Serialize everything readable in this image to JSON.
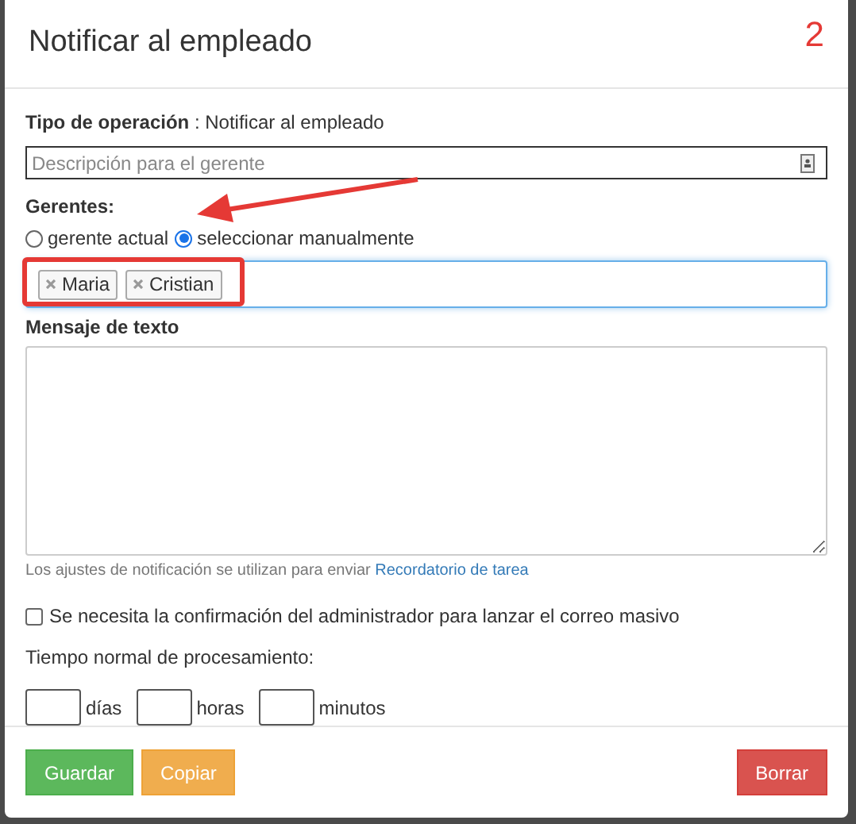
{
  "dialog": {
    "title": "Notificar al empleado",
    "annotation_number": "2"
  },
  "operation": {
    "label": "Tipo de operación",
    "value": " : Notificar al empleado"
  },
  "description_field": {
    "placeholder": "Descripción para el gerente"
  },
  "managers": {
    "label": "Gerentes:",
    "options": [
      {
        "label": "gerente actual",
        "selected": false
      },
      {
        "label": "seleccionar manualmente",
        "selected": true
      }
    ],
    "tags": [
      "Maria",
      "Cristian"
    ],
    "highlighted": true
  },
  "message": {
    "label": "Mensaje de texto"
  },
  "note": {
    "text": "Los ajustes de notificación se utilizan para enviar ",
    "link": "Recordatorio de tarea"
  },
  "confirmation": {
    "label": "Se necesita la confirmación del administrador para lanzar el correo masivo",
    "checked": false
  },
  "processing": {
    "label": "Tiempo normal de procesamiento:",
    "units": [
      "días",
      "horas",
      "minutos"
    ]
  },
  "buttons": [
    {
      "label": "Guardar",
      "kind": "save"
    },
    {
      "label": "Copiar",
      "kind": "copy"
    },
    {
      "label": "Borrar",
      "kind": "delete"
    }
  ]
}
